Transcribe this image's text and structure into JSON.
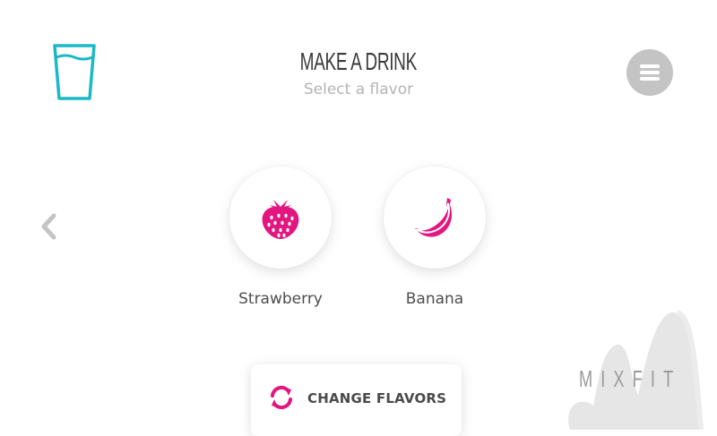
{
  "header": {
    "title": "MAKE A DRINK",
    "subtitle": "Select a flavor"
  },
  "icons": {
    "glass": "drink-glass-icon",
    "menu": "hamburger-menu-icon",
    "back": "chevron-left-icon",
    "change": "refresh-icon"
  },
  "flavors": [
    {
      "label": "Strawberry",
      "icon": "strawberry-icon"
    },
    {
      "label": "Banana",
      "icon": "banana-icon"
    }
  ],
  "change_button": {
    "label": "CHANGE FLAVORS"
  },
  "logo": {
    "text": "MIXFIT"
  },
  "colors": {
    "accent_teal": "#1bb8c6",
    "flavor_pink": "#e3157f",
    "menu_gray": "#c4c4c4",
    "text_dark": "#3a3a3a",
    "text_muted": "#b4b4b4"
  }
}
